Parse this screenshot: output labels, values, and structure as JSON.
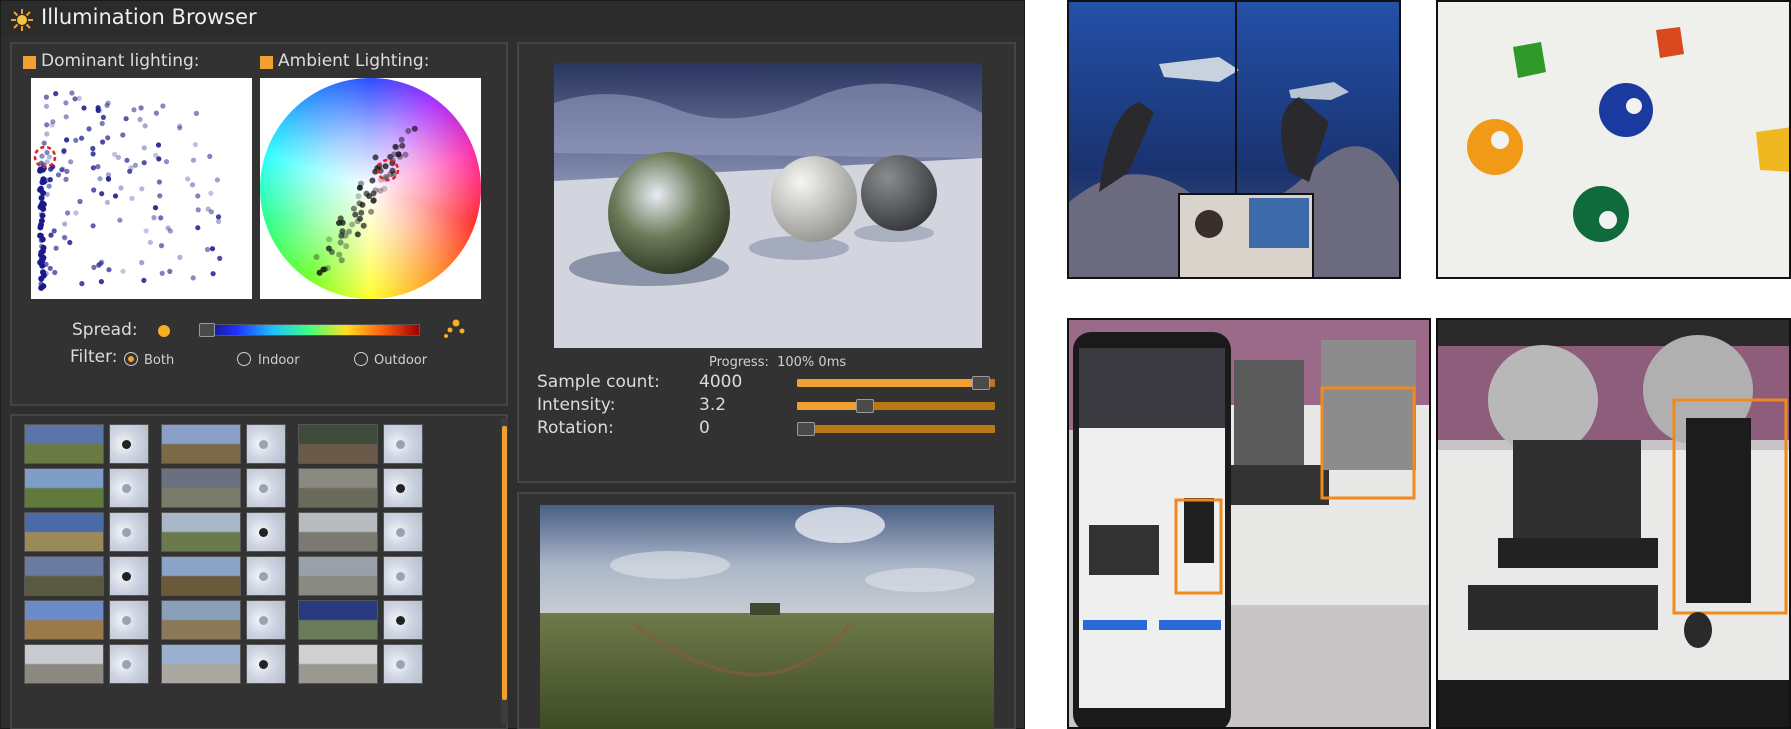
{
  "app": {
    "title": "Illumination Browser",
    "accent_color": "#f0a032",
    "logo_icon": "sun-icon"
  },
  "lighting": {
    "dominant_label": "Dominant lighting:",
    "ambient_label": "Ambient Lighting:"
  },
  "spread": {
    "label": "Spread:"
  },
  "filter": {
    "label": "Filter:",
    "options": [
      "Both",
      "Indoor",
      "Outdoor"
    ],
    "selected": "Both"
  },
  "render": {
    "progress_text": "Progress:  100% 0ms"
  },
  "params": [
    {
      "label": "Sample count:",
      "value": "4000",
      "fill": 0.97
    },
    {
      "label": "Intensity:",
      "value": "3.2",
      "fill": 0.33
    },
    {
      "label": "Rotation:",
      "value": "0",
      "fill": 0.0
    }
  ],
  "photos": {
    "panel_icons": [
      "aquarium-vr-photo",
      "billiard-balls-photo",
      "phone-ar-photo",
      "office-desk-photo"
    ]
  }
}
